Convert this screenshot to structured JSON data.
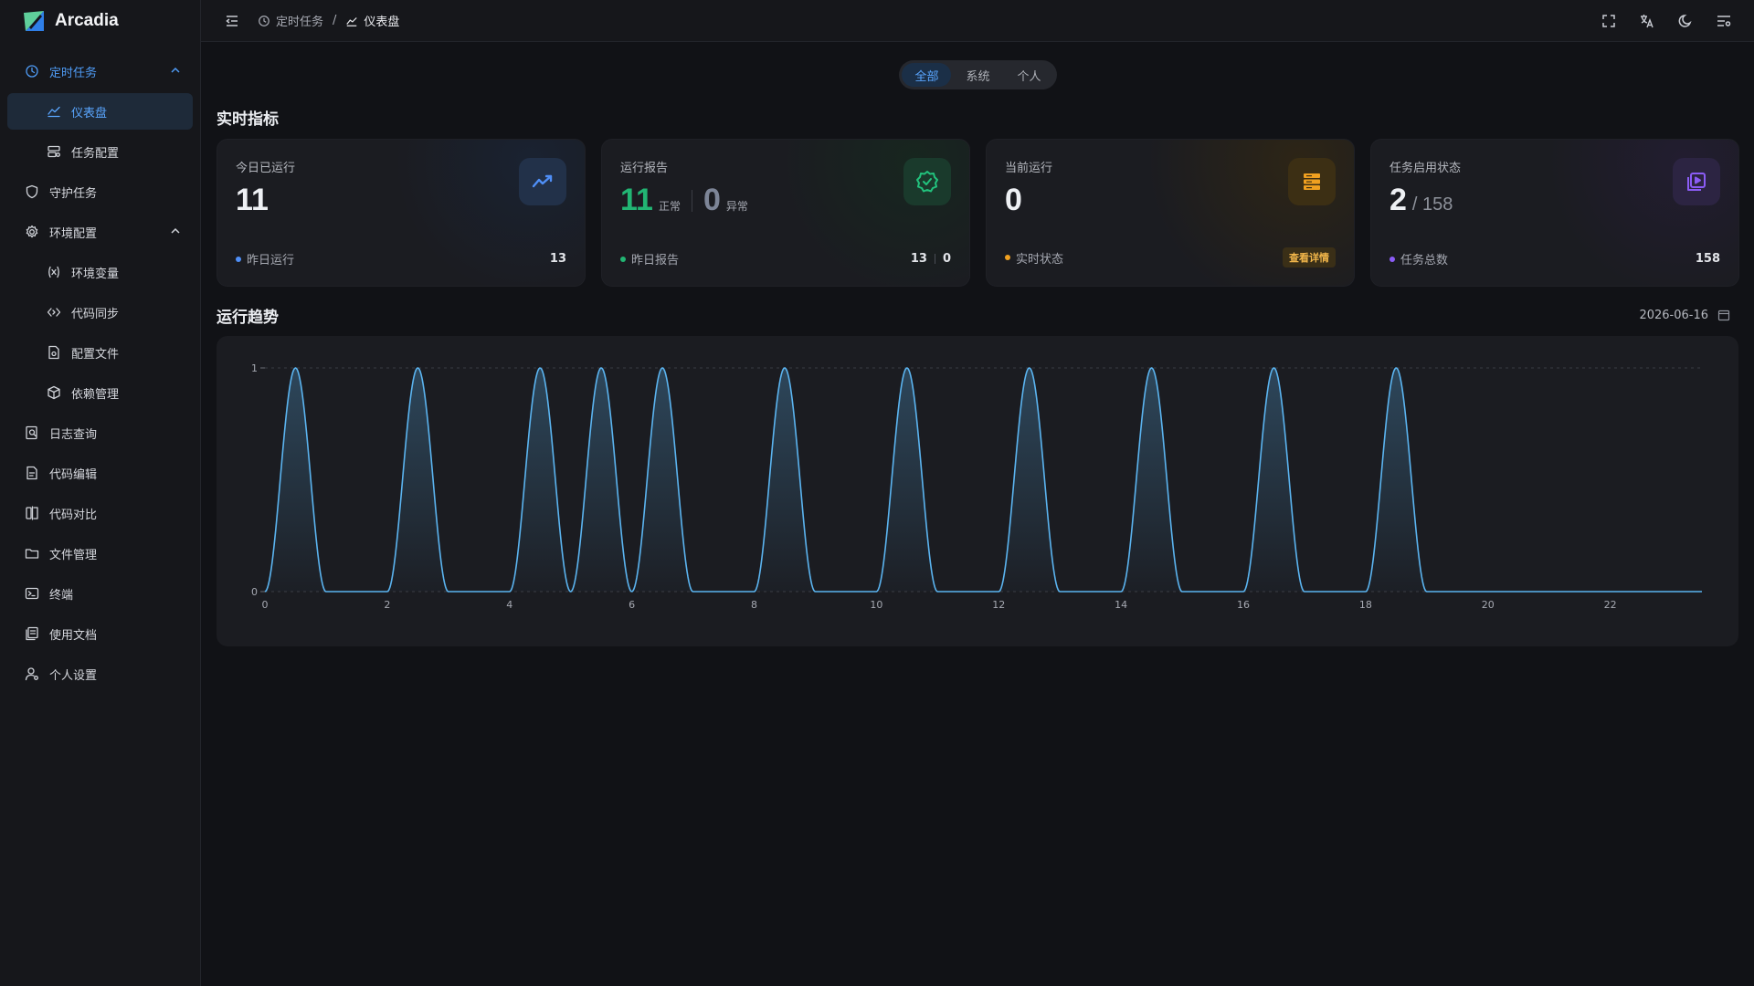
{
  "brand": {
    "name": "Arcadia"
  },
  "sidebar": {
    "items": [
      {
        "label": "定时任务",
        "icon": "clock-icon",
        "state": "active-parent",
        "expandable": true
      },
      {
        "label": "仪表盘",
        "icon": "chart-line-icon",
        "state": "active",
        "sub": true
      },
      {
        "label": "任务配置",
        "icon": "server-config-icon",
        "sub": true
      },
      {
        "label": "守护任务",
        "icon": "shield-refresh-icon"
      },
      {
        "label": "环境配置",
        "icon": "gear-icon",
        "expandable": true
      },
      {
        "label": "环境变量",
        "icon": "variable-icon",
        "sub": true
      },
      {
        "label": "代码同步",
        "icon": "code-sync-icon",
        "sub": true
      },
      {
        "label": "配置文件",
        "icon": "file-gear-icon",
        "sub": true
      },
      {
        "label": "依赖管理",
        "icon": "package-icon",
        "sub": true
      },
      {
        "label": "日志查询",
        "icon": "log-search-icon"
      },
      {
        "label": "代码编辑",
        "icon": "code-edit-icon"
      },
      {
        "label": "代码对比",
        "icon": "diff-icon"
      },
      {
        "label": "文件管理",
        "icon": "folder-icon"
      },
      {
        "label": "终端",
        "icon": "terminal-icon"
      },
      {
        "label": "使用文档",
        "icon": "docs-icon"
      },
      {
        "label": "个人设置",
        "icon": "user-settings-icon"
      }
    ]
  },
  "header": {
    "breadcrumb": [
      {
        "label": "定时任务",
        "icon": "clock-icon"
      },
      {
        "label": "仪表盘",
        "icon": "chart-line-icon"
      }
    ],
    "separator": "/",
    "actions": [
      "fullscreen-icon",
      "translate-icon",
      "moon-icon",
      "settings-panel-icon"
    ]
  },
  "filter": {
    "options": [
      "全部",
      "系统",
      "个人"
    ],
    "selected": "全部"
  },
  "metrics": {
    "title": "实时指标",
    "cards": {
      "today": {
        "label": "今日已运行",
        "value": "11",
        "foot_label": "昨日运行",
        "foot_value": "13",
        "icon": "trend-up-icon",
        "accent": "#4f8ff7"
      },
      "report": {
        "label": "运行报告",
        "ok_value": "11",
        "ok_unit": "正常",
        "err_value": "0",
        "err_unit": "异常",
        "foot_label": "昨日报告",
        "foot_ok": "13",
        "foot_err": "0",
        "icon": "badge-check-icon",
        "accent": "#22b573"
      },
      "running": {
        "label": "当前运行",
        "value": "0",
        "foot_label": "实时状态",
        "foot_tag": "查看详情",
        "icon": "server-stack-icon",
        "accent": "#f0a020"
      },
      "enabled": {
        "label": "任务启用状态",
        "value": "2",
        "total": "/ 158",
        "foot_label": "任务总数",
        "foot_value": "158",
        "icon": "play-library-icon",
        "accent": "#8b5cf6"
      }
    }
  },
  "trend": {
    "title": "运行趋势",
    "date": "2026-06-16"
  },
  "chart_data": {
    "type": "area",
    "x_ticks": [
      0,
      2,
      4,
      6,
      8,
      10,
      12,
      14,
      16,
      18,
      20,
      22
    ],
    "y_ticks": [
      0,
      1
    ],
    "xlim": [
      0,
      23.5
    ],
    "ylim": [
      0,
      1
    ],
    "series": [
      {
        "x": [
          0.5,
          2.5,
          4.5,
          5.5,
          6.5,
          8.5,
          10.5,
          12.5,
          14.5,
          16.5,
          18.5
        ],
        "y": [
          1,
          1,
          1,
          1,
          1,
          1,
          1,
          1,
          1,
          1,
          1
        ]
      }
    ],
    "line_color": "#5bb4f0",
    "grid": true
  }
}
